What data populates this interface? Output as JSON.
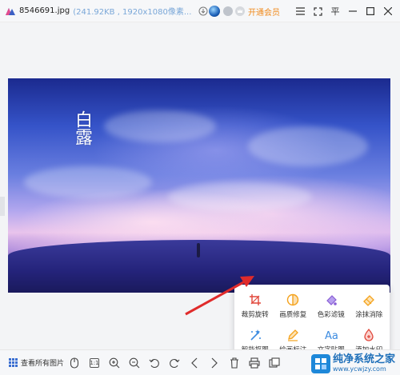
{
  "titlebar": {
    "filename": "8546691.jpg",
    "fileinfo": "(241.92KB  ,  1920x1080像素...",
    "vip_label": "开通会员",
    "pin_label": "平",
    "accent": "#f08a1c"
  },
  "image": {
    "title_text": "白露"
  },
  "tools": [
    {
      "label": "裁剪旋转",
      "icon": "crop-rotate-icon",
      "color": "#e0463a"
    },
    {
      "label": "画质修复",
      "icon": "quality-repair-icon",
      "color": "#f4a21c"
    },
    {
      "label": "色彩滤镜",
      "icon": "color-filter-icon",
      "color": "#8a5fd6"
    },
    {
      "label": "涂抹消除",
      "icon": "eraser-icon",
      "color": "#f4a21c"
    },
    {
      "label": "智能抠图",
      "icon": "smart-cutout-icon",
      "color": "#3c8be0"
    },
    {
      "label": "绘画标注",
      "icon": "brush-annotate-icon",
      "color": "#f4a21c"
    },
    {
      "label": "文字贴图",
      "icon": "text-sticker-icon",
      "color": "#3c8be0"
    },
    {
      "label": "添加水印",
      "icon": "add-watermark-icon",
      "color": "#e0463a"
    }
  ],
  "bottombar": {
    "view_all_label": "查看所有图片",
    "ratio_label": "1:1"
  },
  "watermark": {
    "title": "纯净系统之家",
    "url": "www.ycwjzy.com"
  }
}
